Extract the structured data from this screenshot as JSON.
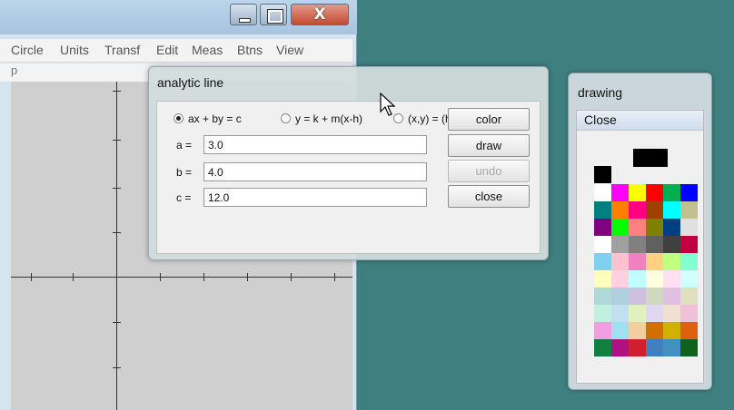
{
  "main_window": {
    "menu": [
      "Circle",
      "Units",
      "Transf",
      "Edit",
      "Meas",
      "Btns",
      "View"
    ],
    "toolbar_fragment": "p",
    "caption_close": "X"
  },
  "analytic_dialog": {
    "title": "analytic line",
    "radios": [
      {
        "label": "ax + by = c",
        "selected": true
      },
      {
        "label": "y = k + m(x-h)",
        "selected": false
      },
      {
        "label": "(x,y) = (h,k) + t[a,b]",
        "selected": false
      }
    ],
    "fields": [
      {
        "label": "a =",
        "value": "3.0"
      },
      {
        "label": "b =",
        "value": "4.0"
      },
      {
        "label": "c =",
        "value": "12.0"
      }
    ],
    "buttons": {
      "color": "color",
      "draw": "draw",
      "undo": "undo",
      "close": "close"
    }
  },
  "drawing_window": {
    "title": "drawing",
    "close_label": "Close",
    "colors": {
      "current_big": "#000000",
      "current_small": "#000000",
      "rows": [
        [
          "#ffffff",
          "#ff00ff",
          "#ffff00",
          "#ff0000",
          "#00b050",
          "#0000ff"
        ],
        [
          "#008080",
          "#ff8000",
          "#ff0080",
          "#a04000",
          "#00ffff",
          "#c0c090"
        ],
        [
          "#800080",
          "#00ff00",
          "#ff8080",
          "#808000",
          "#004080",
          "#e0e0e0"
        ],
        [
          "#ffffff",
          "#a0a0a0",
          "#808080",
          "#606060",
          "#404040",
          "#c00040"
        ],
        [
          "#80d0f0",
          "#ffc0d0",
          "#f080c0",
          "#ffd080",
          "#c0ff80",
          "#80ffd0"
        ],
        [
          "#ffffc0",
          "#ffd0e0",
          "#c0ffff",
          "#ffffe0",
          "#ffe0f0",
          "#d0ffff"
        ],
        [
          "#b0d8d8",
          "#b0d0e0",
          "#d0c0e0",
          "#d0d8c0",
          "#e0c0e0",
          "#e0e0c0"
        ],
        [
          "#c0f0e0",
          "#c0e0f0",
          "#e0f0c0",
          "#e0d8f0",
          "#f0e0d0",
          "#f0c0d8"
        ],
        [
          "#f0a0e0",
          "#a0e0f0",
          "#f0d0a0",
          "#d07000",
          "#d0b000",
          "#e06010"
        ],
        [
          "#108040",
          "#b01080",
          "#d02030",
          "#4080c0",
          "#4090c0",
          "#106020"
        ]
      ]
    }
  }
}
